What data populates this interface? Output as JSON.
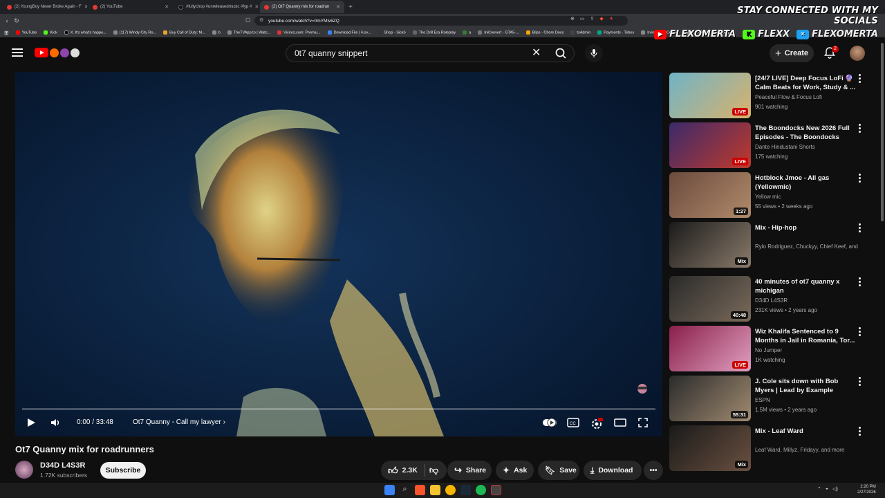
{
  "browser": {
    "tabs": [
      {
        "label": "(2) YoungBoy Never Broke Again - F",
        "active": false
      },
      {
        "label": "(2) YouTube",
        "active": false
      },
      {
        "label": "#fullychop #unreleasedmusic #fyp #",
        "active": false
      },
      {
        "label": "(2) Ot7 Quanny mix for roadrun",
        "active": true
      }
    ],
    "url": "youtube.com/watch?v=0mYMlv6ZQ",
    "bookmarks": [
      "YouTube",
      "Kick",
      "X. It's what's happe...",
      "(117) Windy City Ro...",
      "Buy Call of Duty: M...",
      "b",
      "TheTVApp.to | Watc...",
      "Vicirez.com: Premiu...",
      "Download File | 4.ov...",
      "Shop - Sickö",
      "The Drill Era Roleplay",
      "a",
      "IniConvert - GTA5-...",
      "Blips - Chore Docs",
      "txAdmin",
      "Payments - Tebex",
      "Irving Park Colonis",
      "The Drill Era Roleplay"
    ]
  },
  "overlay": {
    "title": "STAY CONNECTED WITH MY SOCIALS",
    "socials": [
      {
        "icon": "youtube-icon",
        "label": "FLEXOMERTA",
        "color": "#ff0000"
      },
      {
        "icon": "kick-icon",
        "label": "FLEXX",
        "color": "#53fc18"
      },
      {
        "icon": "x-icon",
        "label": "FLEXOMERTA",
        "color": "#1da1f2"
      }
    ]
  },
  "masthead": {
    "search_value": "0t7 quanny snippert",
    "create_label": "Create",
    "notification_count": "2"
  },
  "player": {
    "time": "0:00 / 33:48",
    "chapter": "Ot7 Quanny - Call my lawyer",
    "progress": 0.0
  },
  "video": {
    "title": "Ot7 Quanny mix for roadrunners",
    "channel": "D34D L4S3R",
    "subscribers": "1.72K subscribers",
    "subscribe_label": "Subscribe",
    "likes": "2.3K",
    "share_label": "Share",
    "ask_label": "Ask",
    "save_label": "Save",
    "download_label": "Download"
  },
  "recommendations": [
    {
      "title": "[24/7 LIVE] Deep Focus LoFi 🔮 Calm Beats for Work, Study & ...",
      "channel": "Peaceful Flow & Focus Lofi",
      "meta": "901 watching",
      "badge": "LIVE",
      "live": true,
      "thumb": [
        "#6fb3c7",
        "#d9b26b"
      ]
    },
    {
      "title": "The Boondocks New 2026 Full Episodes - The Boondocks Full...",
      "channel": "Dante Hindustani Shorts",
      "meta": "175 watching",
      "badge": "LIVE",
      "live": true,
      "thumb": [
        "#3b2a6b",
        "#c0392b"
      ]
    },
    {
      "title": "Hotblock Jmoe - All gas (Yellowmic)",
      "channel": "Yellow mic",
      "meta": "55 views • 2 weeks ago",
      "badge": "1:27",
      "live": false,
      "thumb": [
        "#6b4b3e",
        "#b08a6a"
      ]
    },
    {
      "title": "Mix - Hip-hop",
      "channel": "Rylo Rodriguez, Chuckyy, Chief Keef, and ...",
      "meta": "",
      "badge": "Mix",
      "live": false,
      "thumb": [
        "#1b1b1b",
        "#8a7a6a"
      ]
    },
    {
      "title": "40 minutes of ot7 quanny x michigan",
      "channel": "D34D L4S3R",
      "meta": "231K views • 2 years ago",
      "badge": "40:48",
      "live": false,
      "thumb": [
        "#2a2a2a",
        "#7a6a5a"
      ]
    },
    {
      "title": "Wiz Khalifa Sentenced to 9 Months in Jail in Romania, Tor...",
      "channel": "No Jumper",
      "meta": "1K watching",
      "badge": "LIVE",
      "live": true,
      "thumb": [
        "#8a1f4a",
        "#e0a0c0"
      ]
    },
    {
      "title": "J. Cole sits down with Bob Myers | Lead by Example",
      "channel": "ESPN",
      "meta": "1.5M views • 2 years ago",
      "badge": "55:31",
      "live": false,
      "thumb": [
        "#2b2b2b",
        "#a08a70"
      ]
    },
    {
      "title": "Mix - Leaf Ward",
      "channel": "Leaf Ward, Millyz, Fridayy, and more",
      "meta": "",
      "badge": "Mix",
      "live": false,
      "thumb": [
        "#1a1a1a",
        "#6a5040"
      ]
    }
  ],
  "taskbar": {
    "time": "2:20 PM",
    "date": "2/27/2026"
  }
}
